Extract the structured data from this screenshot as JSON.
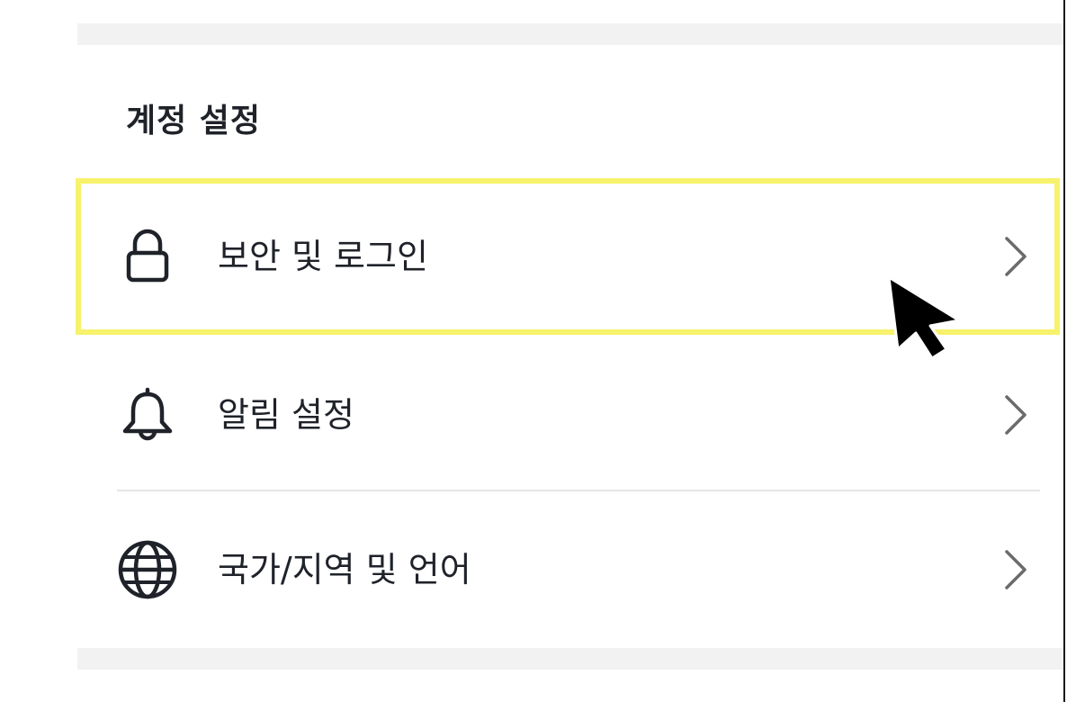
{
  "section": {
    "title": "계정 설정"
  },
  "menu": {
    "items": [
      {
        "label": "보안 및 로그인",
        "icon": "lock-icon",
        "highlighted": true
      },
      {
        "label": "알림 설정",
        "icon": "bell-icon",
        "highlighted": false
      },
      {
        "label": "국가/지역 및 언어",
        "icon": "globe-icon",
        "highlighted": false
      }
    ]
  },
  "colors": {
    "highlight": "#f7f26b",
    "text": "#1f2229",
    "divider": "#e6e6e6",
    "section_gap": "#f2f2f3",
    "chevron": "#6b6b6b"
  }
}
